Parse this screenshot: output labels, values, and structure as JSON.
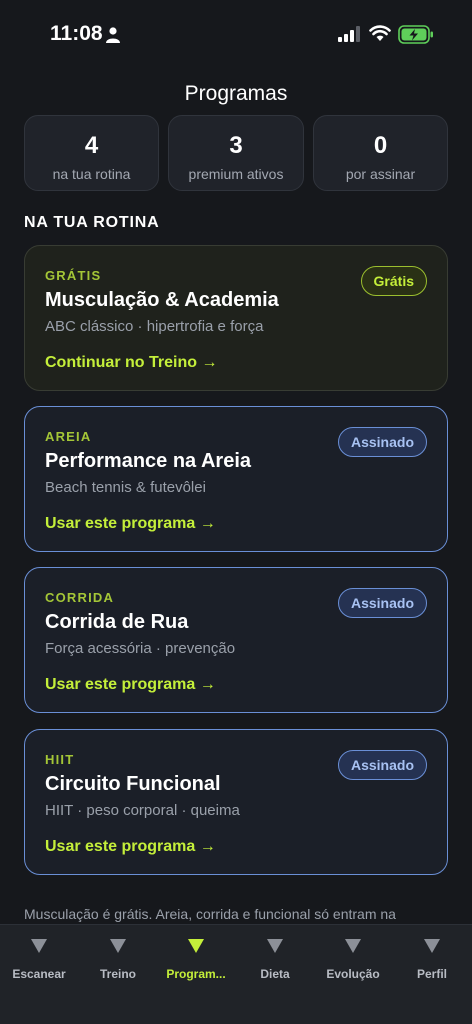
{
  "status_bar": {
    "time": "11:08"
  },
  "header": {
    "title": "Programas"
  },
  "stats": [
    {
      "value": "4",
      "label": "na tua rotina"
    },
    {
      "value": "3",
      "label": "premium ativos"
    },
    {
      "value": "0",
      "label": "por assinar"
    }
  ],
  "section": {
    "heading": "NA TUA ROTINA"
  },
  "programs": [
    {
      "category": "GRÁTIS",
      "title": "Musculação & Academia",
      "subtitle": "ABC clássico · hipertrofia e força",
      "action": "Continuar no Treino →",
      "badge": "Grátis"
    },
    {
      "category": "AREIA",
      "title": "Performance na Areia",
      "subtitle": "Beach tennis & futevôlei",
      "action": "Usar este programa →",
      "badge": "Assinado"
    },
    {
      "category": "CORRIDA",
      "title": "Corrida de Rua",
      "subtitle": "Força acessória · prevenção",
      "action": "Usar este programa →",
      "badge": "Assinado"
    },
    {
      "category": "HIIT",
      "title": "Circuito Funcional",
      "subtitle": "HIIT · peso corporal · queima",
      "action": "Usar este programa →",
      "badge": "Assinado"
    }
  ],
  "footnote": "Musculação é grátis. Areia, corrida e funcional só entram na",
  "nav": {
    "items": [
      {
        "label": "Escanear",
        "icon": "triangle-down-icon"
      },
      {
        "label": "Treino",
        "icon": "triangle-down-icon"
      },
      {
        "label": "Program...",
        "icon": "triangle-down-icon",
        "active": true
      },
      {
        "label": "Dieta",
        "icon": "triangle-down-icon"
      },
      {
        "label": "Evolução",
        "icon": "triangle-down-icon"
      },
      {
        "label": "Perfil",
        "icon": "triangle-down-icon"
      }
    ]
  },
  "colors": {
    "accent": "#c4ef3a",
    "subscribed_border": "#6a8fd6",
    "background": "#16181c"
  }
}
